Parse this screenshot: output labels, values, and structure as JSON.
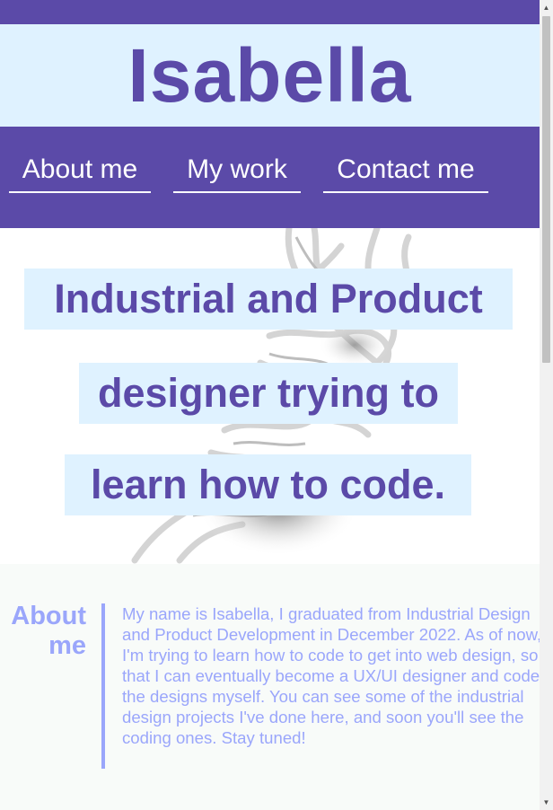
{
  "header": {
    "site_title": "Isabella"
  },
  "nav": {
    "items": [
      {
        "label": "About me"
      },
      {
        "label": "My work"
      },
      {
        "label": "Contact me"
      }
    ]
  },
  "hero": {
    "lines": [
      "Industrial and Product",
      "designer trying to",
      "learn how to code."
    ]
  },
  "about": {
    "title_line1": "About",
    "title_line2": "me",
    "text": "My name is Isabella, I graduated from Industrial Design and Product Development in December 2022. As of now, I'm trying to learn how to code to get into web design, so that I can eventually become a UX/UI designer and code the designs myself. You can see some of the industrial design projects I've done here, and soon you'll see the coding ones. Stay tuned!"
  },
  "icons": {
    "scroll_up": "triangle-up",
    "scroll_down": "triangle-down"
  },
  "colors": {
    "brand_purple": "#5b4aa8",
    "light_blue": "#dff2ff",
    "about_text": "#9aa6fb",
    "about_bg": "#f8fbf9"
  }
}
